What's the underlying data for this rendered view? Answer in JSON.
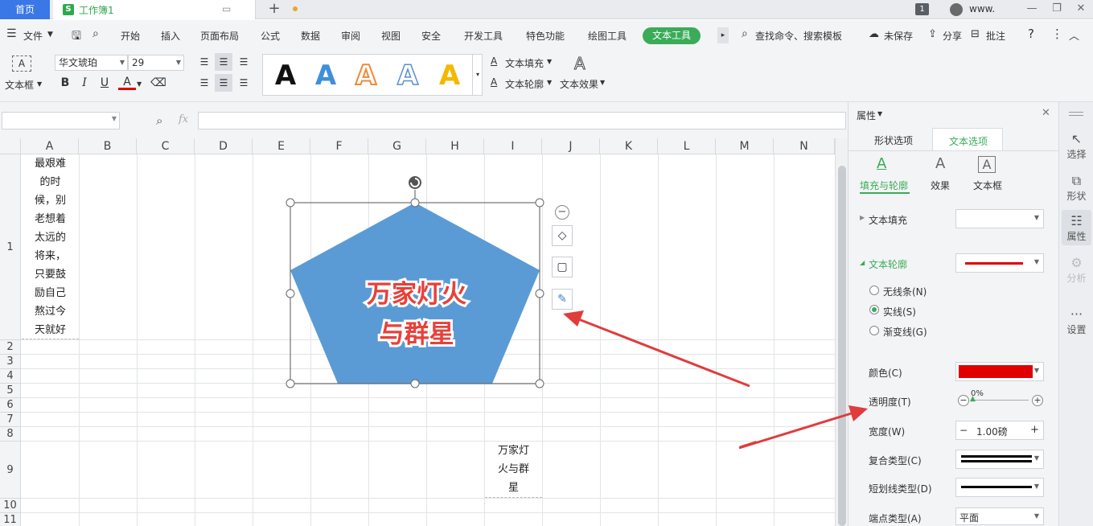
{
  "tabs": {
    "home": "首页",
    "doc_logo": "S",
    "doc_title": "工作簿1",
    "add": "+"
  },
  "window": {
    "badge": "1",
    "user": "www.",
    "minimize": "—",
    "restore": "❐",
    "close": "✕"
  },
  "menu": {
    "file": "文件",
    "items": [
      "开始",
      "插入",
      "页面布局",
      "公式",
      "数据",
      "审阅",
      "视图",
      "安全",
      "开发工具",
      "特色功能",
      "绘图工具"
    ],
    "active": "文本工具",
    "search": "查找命令、搜索模板",
    "unsaved": "未保存",
    "share": "分享",
    "comment": "批注"
  },
  "ribbon": {
    "textbox": "文本框",
    "font_name": "华文琥珀",
    "font_size": "29",
    "bold": "B",
    "italic": "I",
    "underline": "U",
    "color": "A",
    "style_glyph": "A",
    "text_fill": "文本填充",
    "text_outline": "文本轮廓",
    "text_effect": "文本效果"
  },
  "formula": {
    "fx": "fx"
  },
  "grid": {
    "columns": [
      "A",
      "B",
      "C",
      "D",
      "E",
      "F",
      "G",
      "H",
      "I",
      "J",
      "K",
      "L",
      "M",
      "N"
    ],
    "rows": [
      "1",
      "2",
      "3",
      "4",
      "5",
      "6",
      "7",
      "8",
      "9",
      "10",
      "11"
    ],
    "a1_lines": [
      "最艰难",
      "的时",
      "候，别",
      "老想着",
      "太远的",
      "将来，",
      "只要鼓",
      "励自己",
      "熬过今",
      "天就好"
    ],
    "i9_lines": [
      "万家灯",
      "火与群",
      "星"
    ]
  },
  "shape": {
    "text_line1": "万家灯火",
    "text_line2": "与群星",
    "fill": "#5b9bd5",
    "text_color": "#e8403a"
  },
  "panel": {
    "title": "属性",
    "tab_shape": "形状选项",
    "tab_text": "文本选项",
    "sub_fill": "填充与轮廓",
    "sub_effect": "效果",
    "sub_textbox": "文本框",
    "text_fill": "文本填充",
    "text_outline": "文本轮廓",
    "outline_color": "#e00000",
    "no_line": "无线条(N)",
    "solid": "实线(S)",
    "gradient": "渐变线(G)",
    "color_label": "颜色(C)",
    "transparency": "透明度(T)",
    "transparency_value": "0%",
    "width_label": "宽度(W)",
    "width_value": "1.00磅",
    "compound_label": "复合类型(C)",
    "dash_label": "短划线类型(D)",
    "cap_label": "端点类型(A)",
    "cap_value": "平面"
  },
  "rail": {
    "select": "选择",
    "shape": "形状",
    "property": "属性",
    "analyze": "分析",
    "settings": "设置"
  }
}
